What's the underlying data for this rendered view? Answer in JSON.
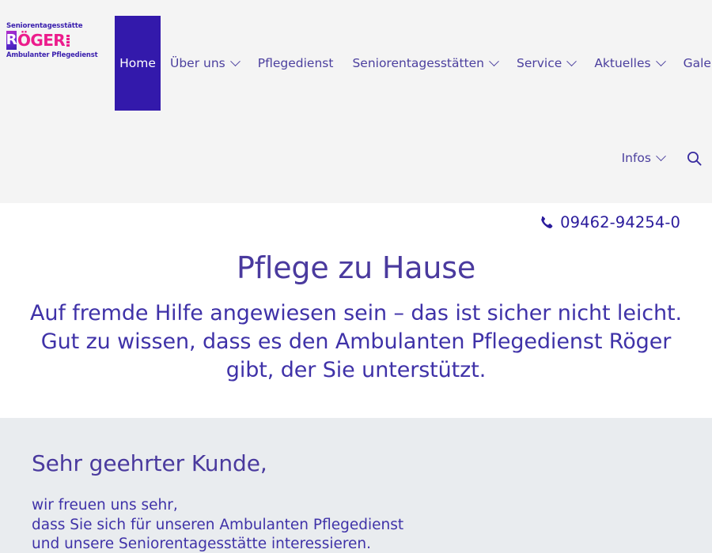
{
  "brand": {
    "logo_line_top": "Seniorentagesstätte",
    "logo_initial": "R",
    "logo_word": "ÖGER",
    "logo_suffix": "GmbH",
    "logo_line_bottom": "Ambulanter Pflegedienst"
  },
  "nav_primary": [
    {
      "label": "Home",
      "has_dropdown": false,
      "active": true
    },
    {
      "label": "Über uns",
      "has_dropdown": true,
      "active": false
    },
    {
      "label": "Pflegedienst",
      "has_dropdown": false,
      "active": false
    },
    {
      "label": "Seniorentagesstätten",
      "has_dropdown": true,
      "active": false
    },
    {
      "label": "Service",
      "has_dropdown": true,
      "active": false
    },
    {
      "label": "Aktuelles",
      "has_dropdown": true,
      "active": false
    },
    {
      "label": "Galerie",
      "has_dropdown": true,
      "active": false
    }
  ],
  "nav_secondary": [
    {
      "label": "Infos",
      "has_dropdown": true
    }
  ],
  "search": {
    "icon": "search-icon",
    "label": "Suche öffnen"
  },
  "contact": {
    "phone_icon": "phone-icon",
    "phone": "09462-94254-0"
  },
  "hero": {
    "title": "Pflege zu Hause",
    "subtitle": "Auf fremde Hilfe angewiesen sein – das ist sicher nicht leicht. Gut zu wissen, dass es den Ambulanten Pflegedienst Röger gibt, der Sie unterstützt."
  },
  "intro": {
    "title": "Sehr geehrter Kunde,",
    "line1": "wir freuen uns sehr,",
    "line2": "dass Sie sich für unseren Ambulanten Pflegedienst",
    "line3": "und unsere Seniorentagesstätte interessieren."
  },
  "colors": {
    "brand_purple": "#3319ab",
    "nav_text": "#4b3f9e",
    "heading": "#4a3a9e",
    "body_text": "#3f32a8",
    "logo_pink": "#ec1c8c",
    "header_bg": "#f4f4f4",
    "intro_bg": "#e9ecef",
    "page_bg": "#ffffff"
  }
}
